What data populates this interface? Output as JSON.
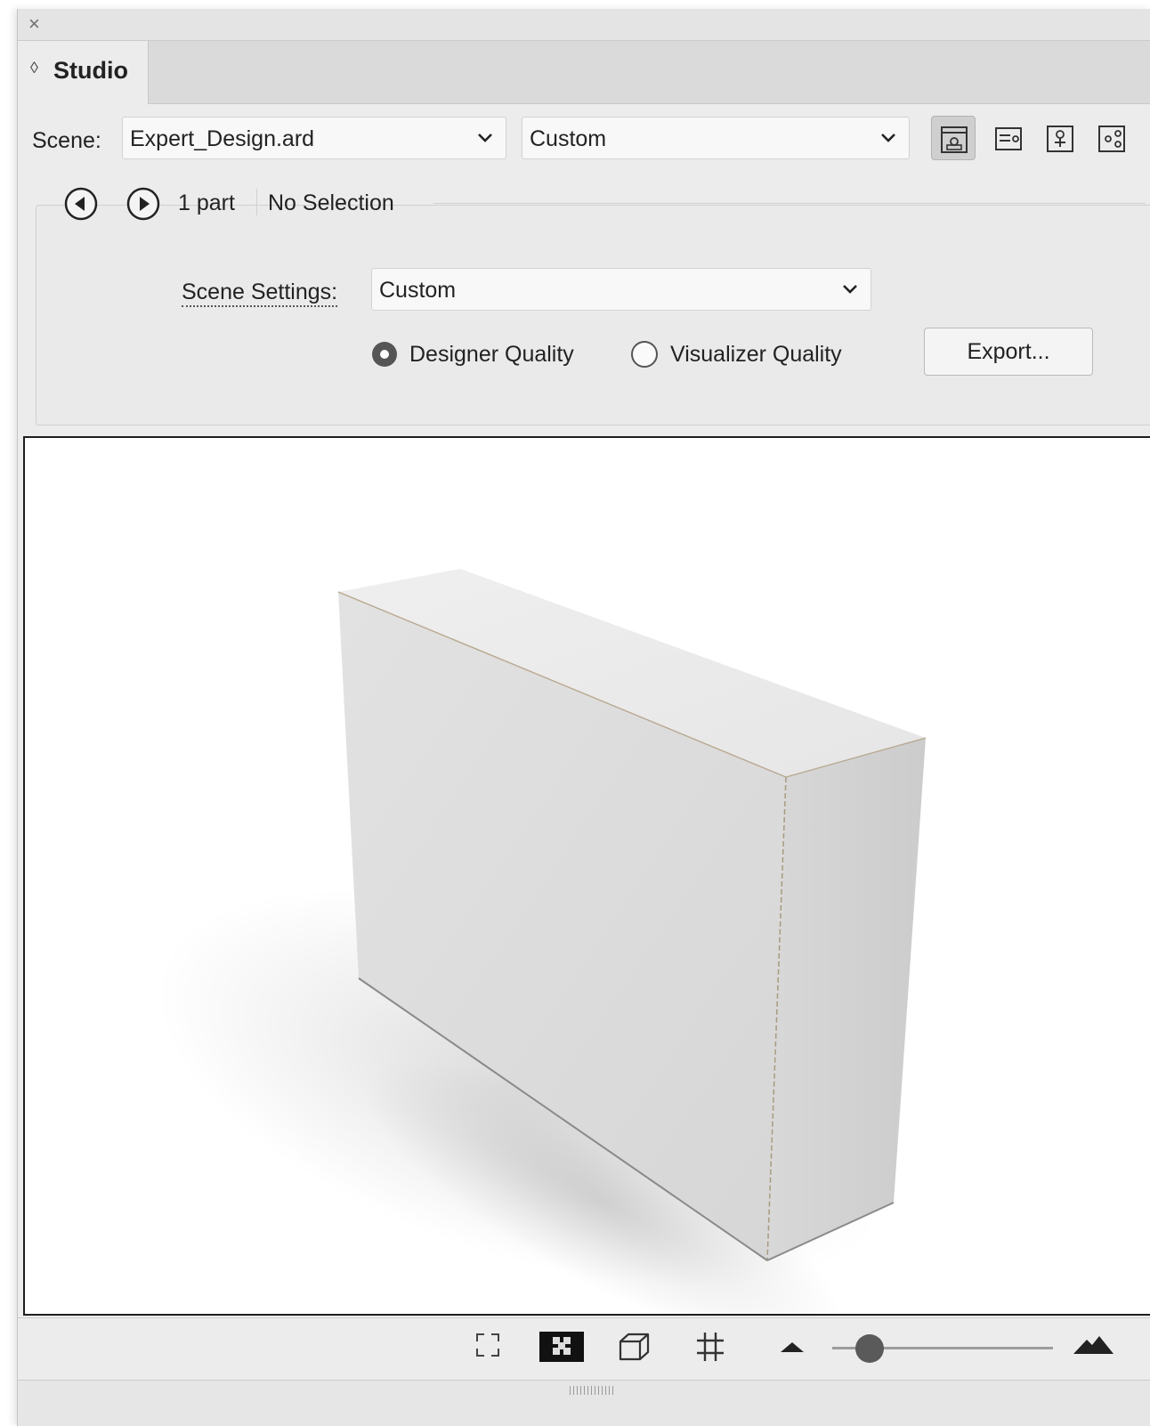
{
  "window": {
    "close_glyph": "×"
  },
  "tab": {
    "arrows": "◊",
    "label": "Studio"
  },
  "scene": {
    "label": "Scene:",
    "file_value": "Expert_Design.ard",
    "preset_value": "Custom"
  },
  "view_buttons": [
    {
      "name": "scene-view-icon",
      "active": true
    },
    {
      "name": "export-view-icon",
      "active": false
    },
    {
      "name": "fold-view-icon",
      "active": false
    },
    {
      "name": "share-view-icon",
      "active": false
    }
  ],
  "navigation": {
    "parts": "1 part",
    "selection": "No Selection"
  },
  "scene_settings": {
    "label": "Scene Settings:",
    "value": "Custom",
    "quality_options": [
      {
        "label": "Designer Quality",
        "selected": true
      },
      {
        "label": "Visualizer Quality",
        "selected": false
      }
    ],
    "export_label": "Export..."
  },
  "toolbar": {
    "tools": [
      "fit-view-icon",
      "background-checker-icon",
      "box-view-icon",
      "grid-icon"
    ],
    "zoom_level": 0.12
  },
  "colors": {
    "panel_bg": "#ececec",
    "viewport_bg": "#ffffff",
    "box_front": "#dcdcdc",
    "box_top": "#eeeeee",
    "box_side": "#d2d2d2"
  }
}
